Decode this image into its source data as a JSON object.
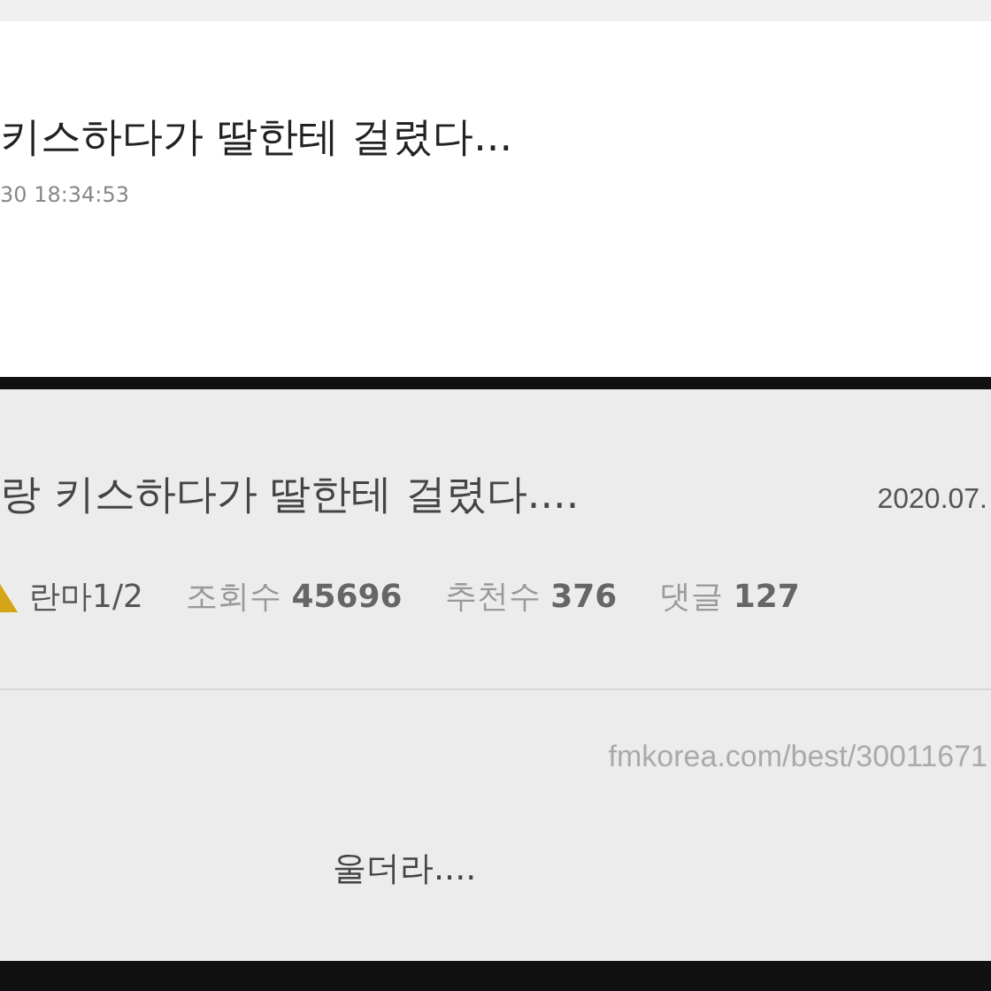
{
  "top_post": {
    "title": "키스하다가 딸한테 걸렸다...",
    "timestamp": "30 18:34:53"
  },
  "bottom_post": {
    "title": "랑 키스하다가 딸한테 걸렸다....",
    "date": "2020.07.",
    "author": "란마1/2",
    "stats": [
      {
        "label": "조회수",
        "value": "45696"
      },
      {
        "label": "추천수",
        "value": "376"
      },
      {
        "label": "댓글",
        "value": "127"
      }
    ],
    "source_url": "fmkorea.com/best/30011671",
    "body": "울더라...."
  }
}
